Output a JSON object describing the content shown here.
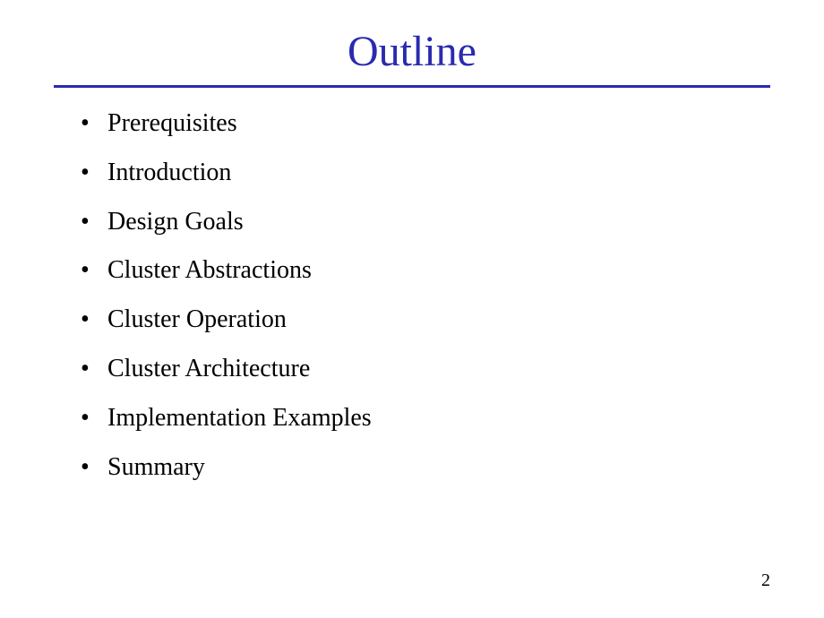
{
  "slide": {
    "title": "Outline",
    "bullets": [
      "Prerequisites",
      "Introduction",
      "Design Goals",
      "Cluster Abstractions",
      "Cluster Operation",
      "Cluster Architecture",
      "Implementation Examples",
      "Summary"
    ],
    "page_number": "2"
  }
}
